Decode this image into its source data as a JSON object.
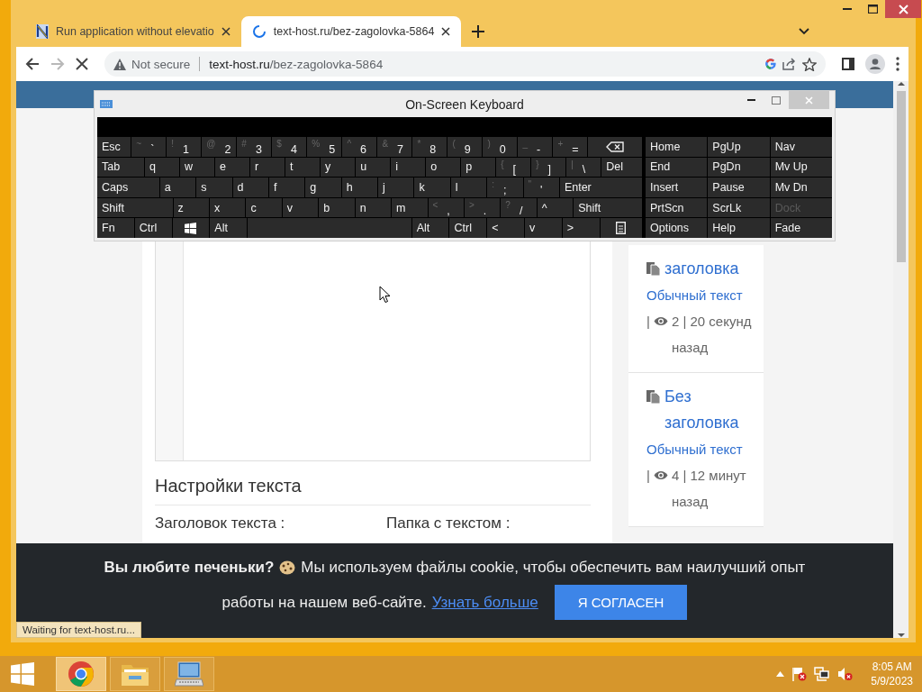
{
  "browser": {
    "tabs": [
      {
        "title": "Run application without elevatio",
        "selected": false,
        "loading": false
      },
      {
        "title": "text-host.ru/bez-zagolovka-5864",
        "selected": true,
        "loading": true
      }
    ],
    "nav": {
      "forward_disabled": true
    },
    "address": {
      "security": "Not secure",
      "host": "text-host.ru",
      "path": "/bez-zagolovka-5864"
    },
    "status": "Waiting for text-host.ru..."
  },
  "page": {
    "settings": {
      "title": "Настройки текста",
      "fields": [
        {
          "label": "Заголовок текста :"
        },
        {
          "label": "Папка с текстом :"
        }
      ]
    },
    "recent": [
      {
        "title": "заголовка",
        "category": "Обычный текст",
        "separator": "|",
        "stats": "2 | 20 секунд назад"
      },
      {
        "title": "Без заголовка",
        "category": "Обычный текст",
        "separator": "|",
        "stats": "4 | 12 минут назад"
      }
    ],
    "cookie": {
      "heading": "Вы любите печеньки?",
      "text": "Мы используем файлы cookie, чтобы обеспечить вам наилучший опыт",
      "text_continued": "работы на нашем веб-сайте.",
      "link": "Узнать больше",
      "button": "Я СОГЛАСЕН"
    }
  },
  "osk": {
    "title": "On-Screen Keyboard",
    "rows": [
      [
        {
          "kind": "label",
          "label": "Esc"
        },
        {
          "kind": "char",
          "shift": "~",
          "label": "`"
        },
        {
          "kind": "char",
          "shift": "!",
          "label": "1"
        },
        {
          "kind": "char",
          "shift": "@",
          "label": "2"
        },
        {
          "kind": "char",
          "shift": "#",
          "label": "3"
        },
        {
          "kind": "char",
          "shift": "$",
          "label": "4"
        },
        {
          "kind": "char",
          "shift": "%",
          "label": "5"
        },
        {
          "kind": "char",
          "shift": "^",
          "label": "6"
        },
        {
          "kind": "char",
          "shift": "&",
          "label": "7"
        },
        {
          "kind": "char",
          "shift": "*",
          "label": "8"
        },
        {
          "kind": "char",
          "shift": "(",
          "label": "9"
        },
        {
          "kind": "char",
          "shift": ")",
          "label": "0"
        },
        {
          "kind": "char",
          "shift": "_",
          "label": "-"
        },
        {
          "kind": "char",
          "shift": "+",
          "label": "="
        },
        {
          "kind": "backspace"
        }
      ],
      [
        {
          "kind": "label",
          "label": "Tab"
        },
        {
          "kind": "label",
          "label": "q"
        },
        {
          "kind": "label",
          "label": "w"
        },
        {
          "kind": "label",
          "label": "e"
        },
        {
          "kind": "label",
          "label": "r"
        },
        {
          "kind": "label",
          "label": "t"
        },
        {
          "kind": "label",
          "label": "y"
        },
        {
          "kind": "label",
          "label": "u"
        },
        {
          "kind": "label",
          "label": "i"
        },
        {
          "kind": "label",
          "label": "o"
        },
        {
          "kind": "label",
          "label": "p"
        },
        {
          "kind": "char",
          "shift": "{",
          "label": "["
        },
        {
          "kind": "char",
          "shift": "}",
          "label": "]"
        },
        {
          "kind": "char",
          "shift": "|",
          "label": "\\"
        },
        {
          "kind": "label",
          "label": "Del"
        }
      ],
      [
        {
          "kind": "label",
          "label": "Caps"
        },
        {
          "kind": "label",
          "label": "a"
        },
        {
          "kind": "label",
          "label": "s"
        },
        {
          "kind": "label",
          "label": "d"
        },
        {
          "kind": "label",
          "label": "f"
        },
        {
          "kind": "label",
          "label": "g"
        },
        {
          "kind": "label",
          "label": "h"
        },
        {
          "kind": "label",
          "label": "j"
        },
        {
          "kind": "label",
          "label": "k"
        },
        {
          "kind": "label",
          "label": "l"
        },
        {
          "kind": "char",
          "shift": ":",
          "label": ";"
        },
        {
          "kind": "char",
          "shift": "\"",
          "label": "'"
        },
        {
          "kind": "label",
          "label": "Enter"
        }
      ],
      [
        {
          "kind": "label",
          "label": "Shift"
        },
        {
          "kind": "label",
          "label": "z"
        },
        {
          "kind": "label",
          "label": "x"
        },
        {
          "kind": "label",
          "label": "c"
        },
        {
          "kind": "label",
          "label": "v"
        },
        {
          "kind": "label",
          "label": "b"
        },
        {
          "kind": "label",
          "label": "n"
        },
        {
          "kind": "label",
          "label": "m"
        },
        {
          "kind": "char",
          "shift": "<",
          "label": ","
        },
        {
          "kind": "char",
          "shift": ">",
          "label": "."
        },
        {
          "kind": "char",
          "shift": "?",
          "label": "/"
        },
        {
          "kind": "label",
          "label": "^"
        },
        {
          "kind": "label",
          "label": "Shift"
        }
      ],
      [
        {
          "kind": "label",
          "label": "Fn"
        },
        {
          "kind": "label",
          "label": "Ctrl"
        },
        {
          "kind": "windows"
        },
        {
          "kind": "label",
          "label": "Alt"
        },
        {
          "kind": "space"
        },
        {
          "kind": "label",
          "label": "Alt"
        },
        {
          "kind": "label",
          "label": "Ctrl"
        },
        {
          "kind": "label",
          "label": "<"
        },
        {
          "kind": "label",
          "label": "v"
        },
        {
          "kind": "label",
          "label": ">"
        },
        {
          "kind": "menu"
        }
      ]
    ],
    "nav_keys": [
      {
        "label": "Home",
        "disabled": false
      },
      {
        "label": "PgUp",
        "disabled": false
      },
      {
        "label": "Nav",
        "disabled": false
      },
      {
        "label": "End",
        "disabled": false
      },
      {
        "label": "PgDn",
        "disabled": false
      },
      {
        "label": "Mv Up",
        "disabled": false
      },
      {
        "label": "Insert",
        "disabled": false
      },
      {
        "label": "Pause",
        "disabled": false
      },
      {
        "label": "Mv Dn",
        "disabled": false
      },
      {
        "label": "PrtScn",
        "disabled": false
      },
      {
        "label": "ScrLk",
        "disabled": false
      },
      {
        "label": "Dock",
        "disabled": true
      },
      {
        "label": "Options",
        "disabled": false
      },
      {
        "label": "Help",
        "disabled": false
      },
      {
        "label": "Fade",
        "disabled": false
      }
    ]
  },
  "taskbar": {
    "apps": [
      {
        "kind": "browser",
        "selected": true
      },
      {
        "kind": "folder",
        "selected": false
      },
      {
        "kind": "keyboard",
        "selected": false
      }
    ],
    "time": "8:05 AM",
    "date": "5/9/2023"
  }
}
